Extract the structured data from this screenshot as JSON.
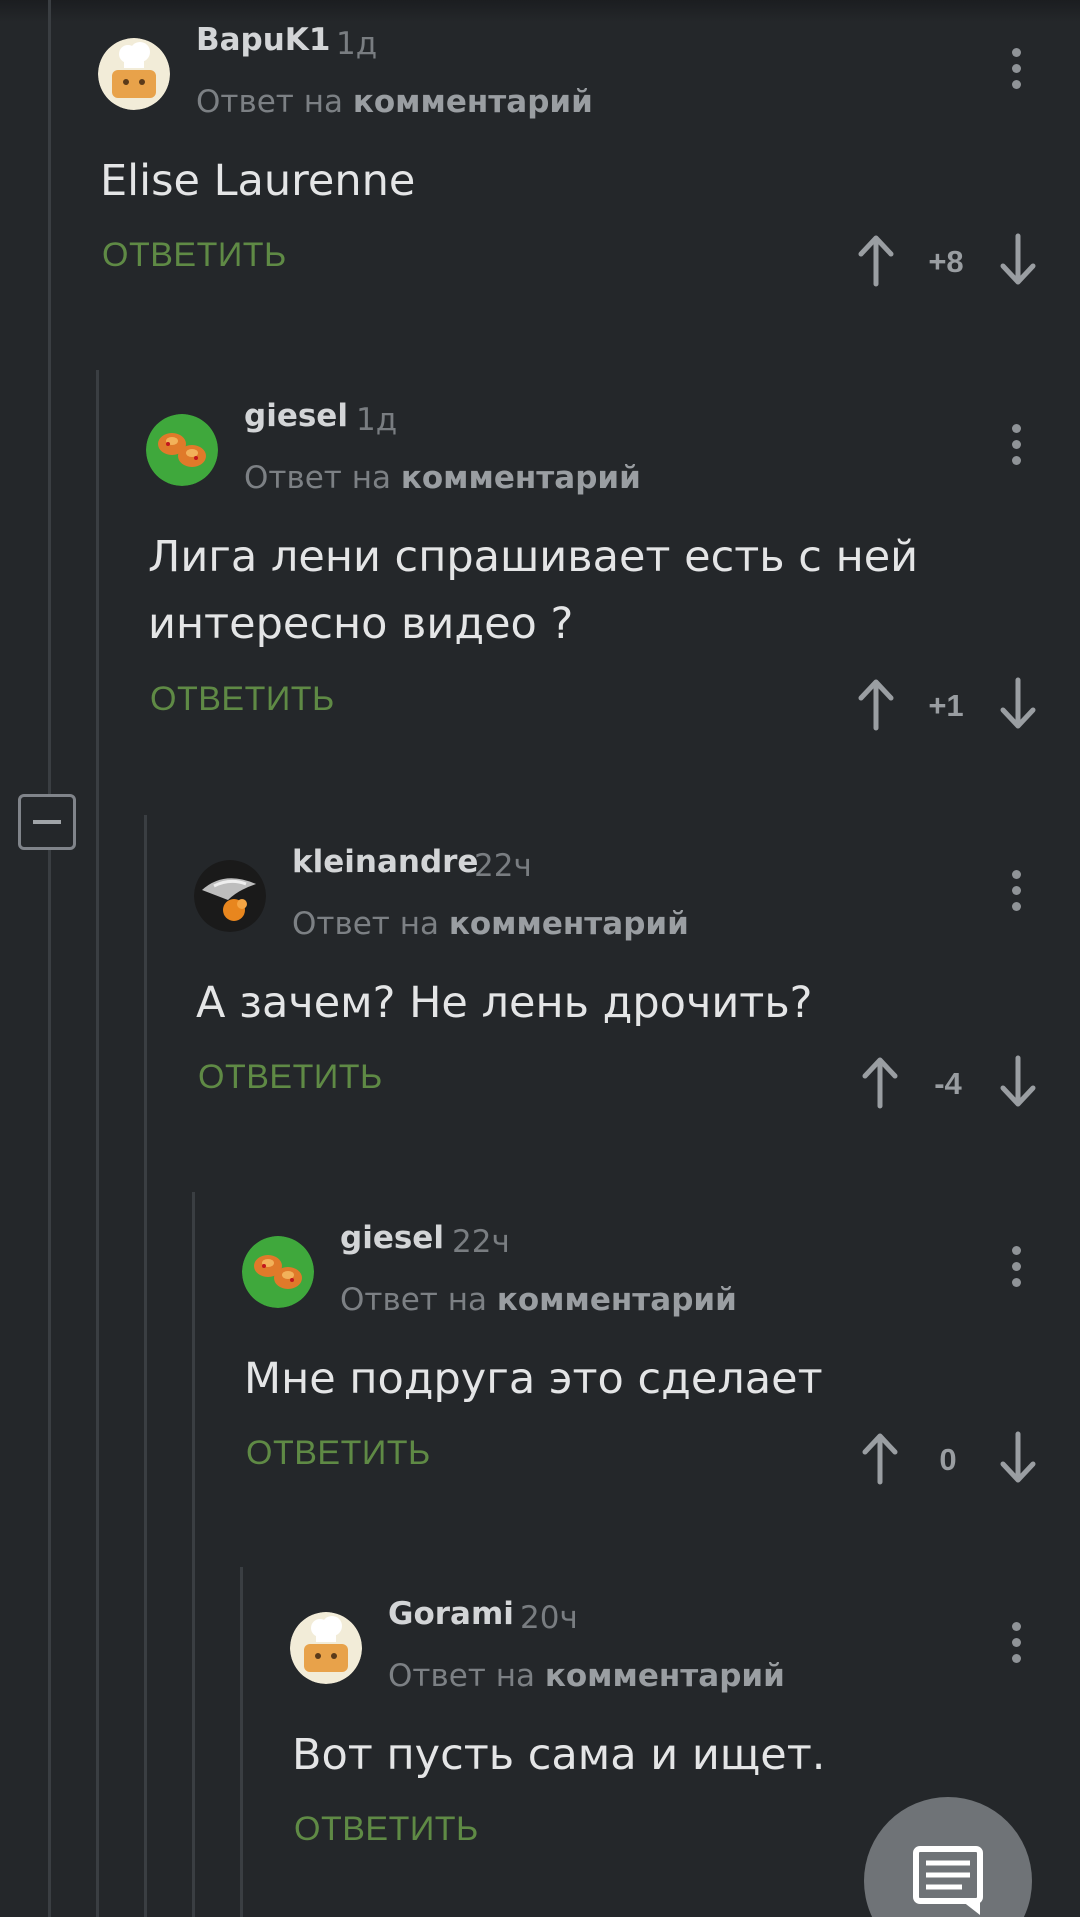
{
  "reply_label": "ОТВЕТИТЬ",
  "reply_to_prefix": "Ответ на",
  "reply_to_link": "комментарий",
  "comments": [
    {
      "author": "ВарuK1",
      "time": "1д",
      "text": "Elise Laurenne",
      "score": "+8",
      "avatar": "chef-icon"
    },
    {
      "author": "giesel",
      "time": "1д",
      "text": "Лига лени спрашивает есть с ней интересно видео ?",
      "score": "+1",
      "avatar": "green-bun-icon"
    },
    {
      "author": "kleinandre",
      "time": "22ч",
      "text": "А зачем? Не лень дрочить?",
      "score": "-4",
      "avatar": "bird-photo-icon"
    },
    {
      "author": "giesel",
      "time": "22ч",
      "text": "Мне подруга это сделает",
      "score": "0",
      "avatar": "green-bun-icon"
    },
    {
      "author": "Gorami",
      "time": "20ч",
      "text": "Вот пусть сама и ищет.",
      "score": "",
      "avatar": "chef-icon"
    }
  ],
  "colors": {
    "background": "#24272a",
    "accent_green": "#5f8a45",
    "thread_line": "#3a3e42"
  }
}
